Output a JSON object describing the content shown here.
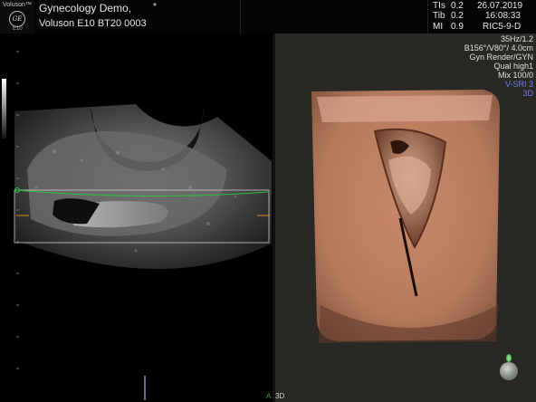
{
  "header": {
    "brand": "Voluson",
    "brand_suffix": "™",
    "model": "E10",
    "patient_name": "Gynecology Demo,",
    "patient_marker": "*",
    "device_line": "Voluson E10 BT20 0003",
    "tis_label": "TIs",
    "tis_value": "0.2",
    "tib_label": "Tib",
    "tib_value": "0.2",
    "mi_label": "MI",
    "mi_value": "0.9",
    "date": "26.07.2019",
    "time": "16:08:33",
    "probe": "RIC5-9-D"
  },
  "params": {
    "p1": "35Hz/1.2",
    "p2": "B156°/V80°/ 4.0cm",
    "p3": "Gyn Render/GYN",
    "p4": "Qual high1",
    "p5": "Mix 100/0",
    "p6": "V-SRI 3",
    "p7": "3D"
  },
  "footer": {
    "label_a": "A",
    "label_3d": "3D"
  },
  "colors": {
    "render_marker": "#4e6cf0",
    "roi_line": "#2fbf3f",
    "depth_marker": "#d98b2a",
    "status_glow": "#7fe07f"
  },
  "icons": {
    "logo": "ge-logo-icon",
    "status": "status-bulb-icon"
  }
}
